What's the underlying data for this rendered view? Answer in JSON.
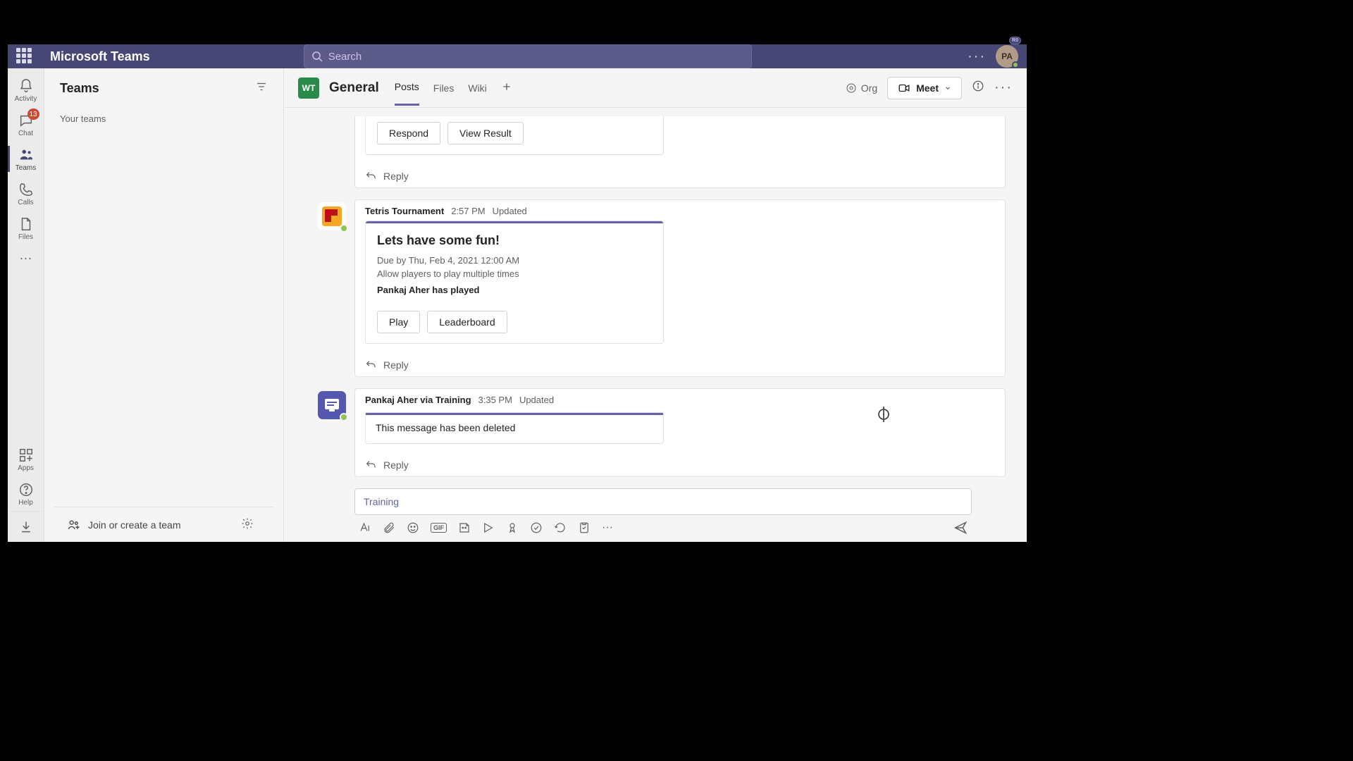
{
  "app_name": "Microsoft Teams",
  "search_placeholder": "Search",
  "avatar_initials": "PA",
  "avatar_small_badge": "R0",
  "rail": {
    "activity": "Activity",
    "chat": "Chat",
    "chat_badge": "13",
    "teams": "Teams",
    "calls": "Calls",
    "files": "Files",
    "apps": "Apps",
    "help": "Help"
  },
  "sidepanel": {
    "title": "Teams",
    "subhead": "Your teams",
    "join_label": "Join or create a team"
  },
  "channel": {
    "team_avatar": "WT",
    "title": "General",
    "tabs": {
      "posts": "Posts",
      "files": "Files",
      "wiki": "Wiki"
    },
    "org_label": "Org",
    "meet_label": "Meet"
  },
  "messages": {
    "m0_btn_respond": "Respond",
    "m0_btn_view": "View Result",
    "m0_reply": "Reply",
    "m1_author": "Tetris Tournament",
    "m1_time": "2:57 PM",
    "m1_status": "Updated",
    "m1_title": "Lets have some fun!",
    "m1_due": "Due by Thu, Feb 4, 2021 12:00 AM",
    "m1_rule": "Allow players to play multiple times",
    "m1_played": "Pankaj Aher has played",
    "m1_btn_play": "Play",
    "m1_btn_leader": "Leaderboard",
    "m1_reply": "Reply",
    "m2_author": "Pankaj Aher via Training",
    "m2_time": "3:35 PM",
    "m2_status": "Updated",
    "m2_text": "This message has been deleted",
    "m2_reply": "Reply"
  },
  "compose": {
    "text": "Training"
  }
}
